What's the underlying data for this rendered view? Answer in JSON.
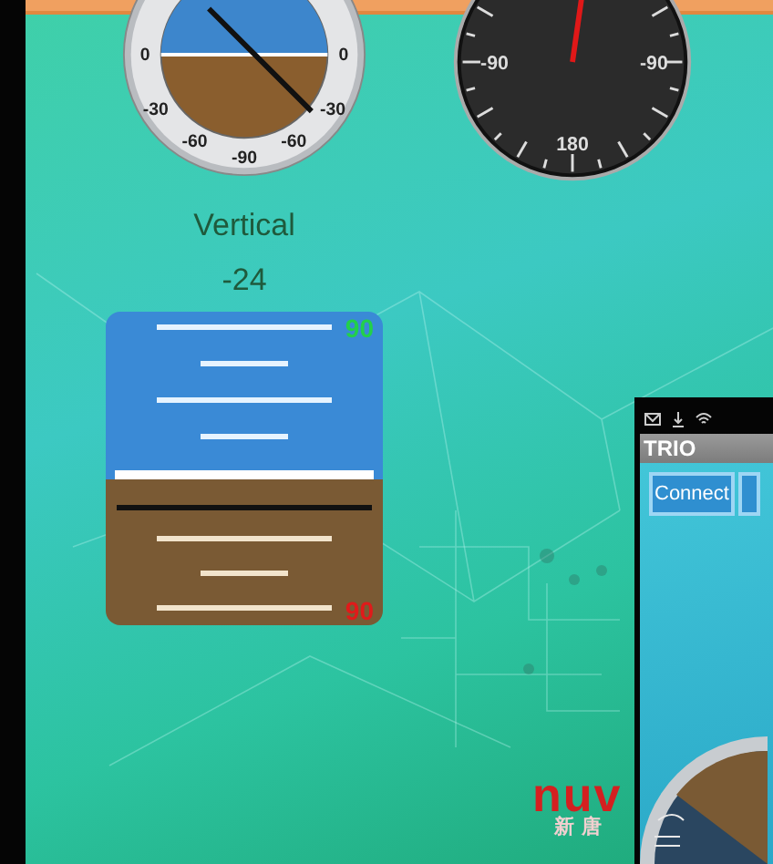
{
  "attitude_gauge": {
    "scale_labels": [
      "0",
      "0",
      "-30",
      "-30",
      "-60",
      "-60",
      "-90"
    ]
  },
  "heading_gauge": {
    "scale_labels": [
      "-90",
      "-90",
      "180"
    ]
  },
  "axis_label": "Vertical",
  "axis_value": "-24",
  "pitch_ladder": {
    "top_label": "90",
    "bottom_label": "90"
  },
  "logo": {
    "wordmark": "nuv",
    "chinese": "新唐"
  },
  "phone_overlay": {
    "app_title": "TRIO",
    "buttons": [
      "Connect"
    ]
  }
}
